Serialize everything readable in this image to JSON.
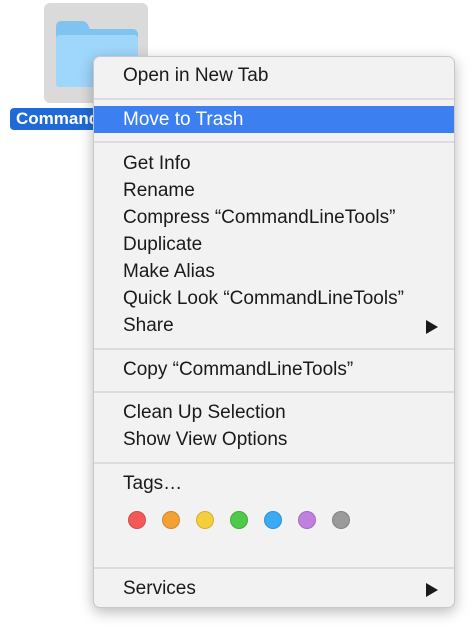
{
  "folder": {
    "name_visible": "Command"
  },
  "menu": {
    "items": [
      {
        "label": "Open in New Tab"
      },
      {
        "label": "Move to Trash"
      },
      {
        "label": "Get Info"
      },
      {
        "label": "Rename"
      },
      {
        "label": "Compress “CommandLineTools”"
      },
      {
        "label": "Duplicate"
      },
      {
        "label": "Make Alias"
      },
      {
        "label": "Quick Look “CommandLineTools”"
      },
      {
        "label": "Share"
      },
      {
        "label": "Copy “CommandLineTools”"
      },
      {
        "label": "Clean Up Selection"
      },
      {
        "label": "Show View Options"
      },
      {
        "label": "Tags…"
      },
      {
        "label": "Services"
      }
    ],
    "highlighted_item": "Move to Trash",
    "tag_colors": [
      {
        "name": "red",
        "color": "#f4595a"
      },
      {
        "name": "orange",
        "color": "#f5a033"
      },
      {
        "name": "yellow",
        "color": "#f6ce3b"
      },
      {
        "name": "green",
        "color": "#4ec94a"
      },
      {
        "name": "blue",
        "color": "#3aaaf4"
      },
      {
        "name": "purple",
        "color": "#c17fe0"
      },
      {
        "name": "gray",
        "color": "#9a9a9a"
      }
    ],
    "highlight_color": "#3b7ff0"
  }
}
